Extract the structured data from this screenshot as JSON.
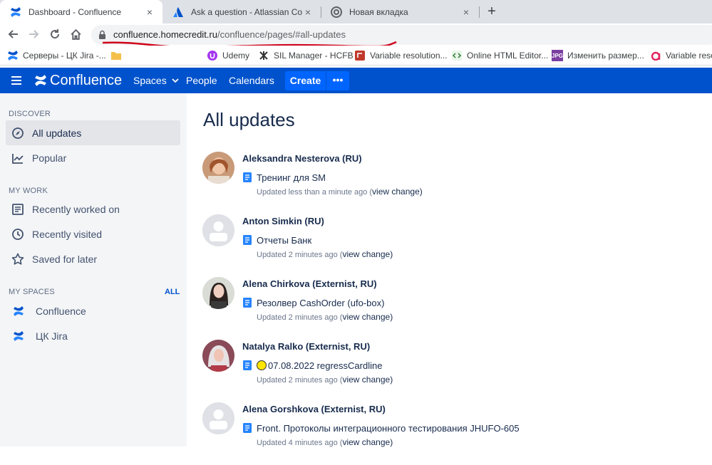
{
  "browser": {
    "tabs": [
      {
        "title": "Dashboard - Confluence",
        "active": true
      },
      {
        "title": "Ask a question - Atlassian Comm",
        "active": false
      },
      {
        "title": "Новая вкладка",
        "active": false
      }
    ],
    "newtab": "+",
    "close": "×",
    "url_host": "confluence.homecredit.ru",
    "url_path": "/confluence/pages/#all-updates",
    "bookmarks": [
      "Серверы - ЦК Jira -...",
      "",
      "Udemy",
      "SIL Manager - HCFB",
      "Variable resolution...",
      "Online HTML Editor...",
      "Изменить размер...",
      "Variable resolu"
    ],
    "bookmark_badges": {
      "jpg": "JPG"
    }
  },
  "nav": {
    "logo": "Confluence",
    "spaces": "Spaces",
    "people": "People",
    "calendars": "Calendars",
    "create": "Create",
    "more": "•••"
  },
  "sidebar": {
    "discover": "DISCOVER",
    "all_updates": "All updates",
    "popular": "Popular",
    "my_work": "MY WORK",
    "recently_worked": "Recently worked on",
    "recently_visited": "Recently visited",
    "saved_later": "Saved for later",
    "my_spaces": "MY SPACES",
    "all": "ALL",
    "spaces": [
      "Confluence",
      "ЦК Jira"
    ]
  },
  "main": {
    "title": "All updates",
    "view_change": "view change",
    "updates": [
      {
        "author": "Aleksandra Nesterova (RU)",
        "page": "Тренинг для SM",
        "time": "Updated less than a minute ago (",
        "avatar": "photo-warm"
      },
      {
        "author": "Anton Simkin (RU)",
        "page": "Отчеты Банк",
        "time": "Updated 2 minutes ago (",
        "avatar": "default"
      },
      {
        "author": "Alena Chirkova (Externist, RU)",
        "page": "Резолвер CashOrder (ufo-box)",
        "time": "Updated 2 minutes ago (",
        "avatar": "photo-dark"
      },
      {
        "author": "Natalya Ralko (Externist, RU)",
        "page": "07.08.2022 regressCardline",
        "time": "Updated 2 minutes ago (",
        "avatar": "photo-blonde",
        "emoji": true
      },
      {
        "author": "Alena Gorshkova (Externist, RU)",
        "page": "Front. Протоколы интеграционного тестирования JHUFO-605",
        "time": "Updated 4 minutes ago (",
        "avatar": "default"
      }
    ]
  },
  "colors": {
    "brand": "#0052cc",
    "create": "#0065ff",
    "sidebar": "#f4f5f7",
    "annotation": "#d0021b"
  }
}
